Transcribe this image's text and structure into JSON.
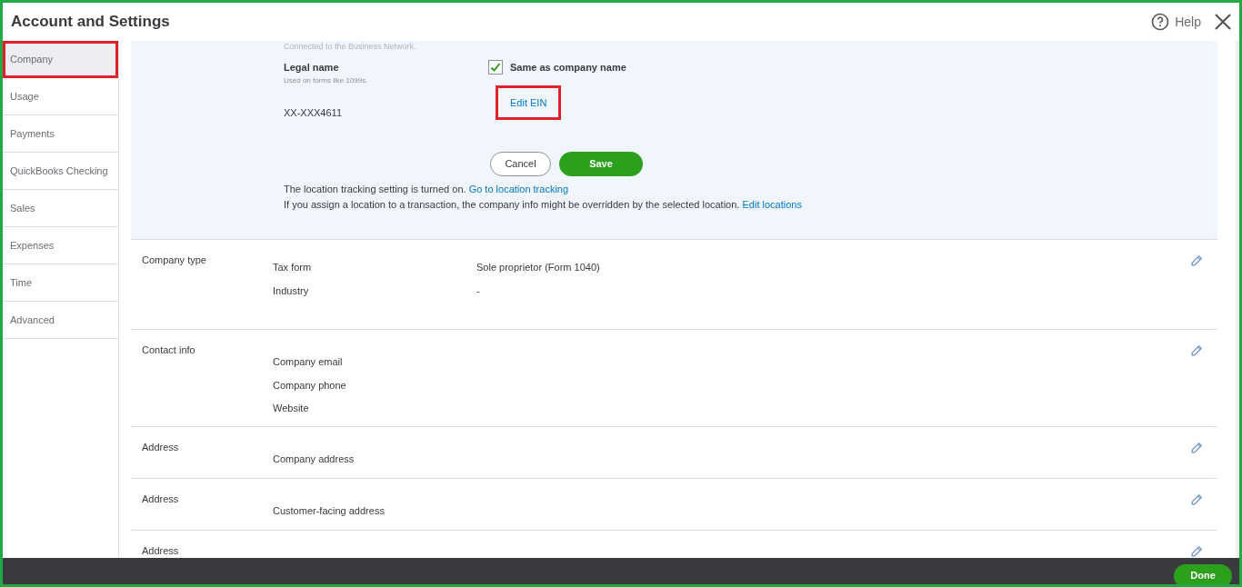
{
  "window": {
    "title": "Account and Settings",
    "help": "Help"
  },
  "sidebar": {
    "items": [
      {
        "label": "Company",
        "selected": true,
        "highlighted": true
      },
      {
        "label": "Usage",
        "selected": false,
        "highlighted": false
      },
      {
        "label": "Payments",
        "selected": false,
        "highlighted": false
      },
      {
        "label": "QuickBooks Checking",
        "selected": false,
        "highlighted": false
      },
      {
        "label": "Sales",
        "selected": false,
        "highlighted": false
      },
      {
        "label": "Expenses",
        "selected": false,
        "highlighted": false
      },
      {
        "label": "Time",
        "selected": false,
        "highlighted": false
      },
      {
        "label": "Advanced",
        "selected": false,
        "highlighted": false
      }
    ]
  },
  "edit_panel": {
    "top_note": "Connected to the Business Network.",
    "legal_name_label": "Legal name",
    "legal_name_hint": "Used on forms like 1099s.",
    "same_as_company": {
      "label": "Same as company name",
      "checked": true
    },
    "ein": "XX-XXX4611",
    "edit_ein": {
      "label": "Edit EIN",
      "highlighted": true
    },
    "cancel": "Cancel",
    "save": "Save",
    "note_1": "The location tracking setting is turned on.",
    "link_1": "Go to location tracking",
    "note_2": "If you assign a location to a transaction, the company info might be overridden by the selected location.",
    "link_2": "Edit locations"
  },
  "sections": [
    {
      "title": "Company type",
      "fields": [
        {
          "label": "Tax form",
          "value": "Sole proprietor (Form 1040)"
        },
        {
          "label": "Industry",
          "value": "-"
        }
      ]
    },
    {
      "title": "Contact info",
      "fields": [
        {
          "label": "Company email"
        },
        {
          "label": "Company phone"
        },
        {
          "label": "Website"
        }
      ]
    },
    {
      "title": "Address",
      "fields": [
        {
          "label": "Company address"
        }
      ]
    },
    {
      "title": "Address",
      "fields": [
        {
          "label": "Customer-facing address"
        }
      ]
    },
    {
      "title": "Address"
    }
  ],
  "footer": {
    "done": "Done"
  }
}
